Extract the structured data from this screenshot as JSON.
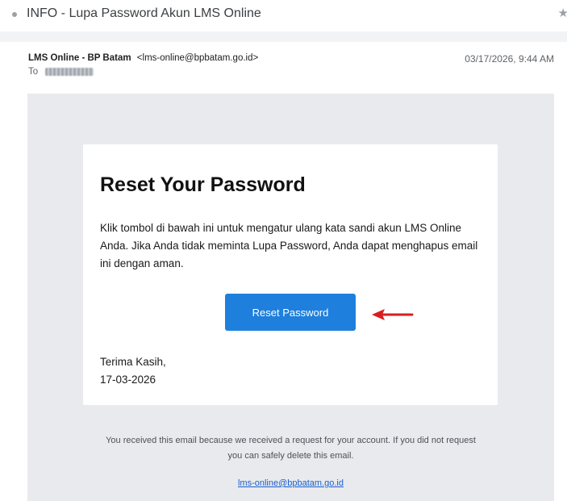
{
  "subject": {
    "title": "INFO - Lupa Password Akun LMS Online",
    "star_icon": "star-icon"
  },
  "header": {
    "sender_name": "LMS Online - BP Batam",
    "sender_email": "<lms-online@bpbatam.go.id>",
    "date": "03/17/2026, 9:44 AM",
    "to_label": "To",
    "recipient": "Isisnoonik"
  },
  "email": {
    "heading": "Reset Your Password",
    "body": "Klik tombol di bawah ini untuk mengatur ulang kata sandi akun LMS Online Anda. Jika Anda tidak meminta Lupa Password, Anda dapat menghapus email ini dengan aman.",
    "button_label": "Reset Password",
    "closing": "Terima Kasih,",
    "closing_date": "17-03-2026",
    "footer_text": "You received this email because we received a request for your account. If you did not request you can safely delete this email.",
    "footer_link": "lms-online@bpbatam.go.id"
  },
  "colors": {
    "button": "#1f7fdc",
    "annotation_arrow": "#d71f1f",
    "canvas": "#e8eaed",
    "link": "#1a5fd0"
  }
}
